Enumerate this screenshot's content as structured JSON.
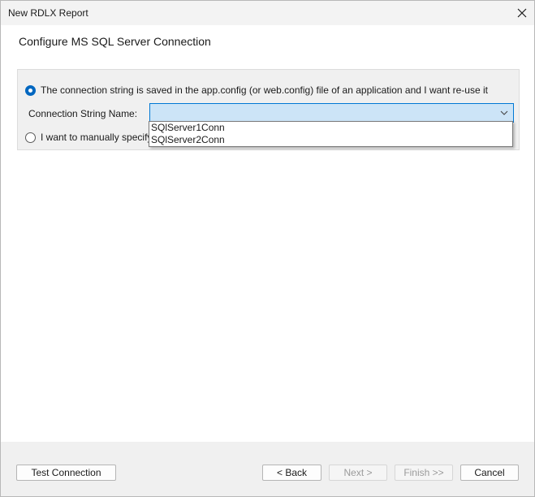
{
  "window": {
    "title": "New RDLX Report",
    "close_icon": "close-icon"
  },
  "page": {
    "heading": "Configure MS SQL Server Connection"
  },
  "options": {
    "use_config_label": "The connection string is saved in the app.config (or web.config) file of an application and I want re-use it",
    "use_config_checked": true,
    "manual_label": "I want to manually specify",
    "manual_checked": false
  },
  "connection_string": {
    "label": "Connection String Name:",
    "value": "",
    "dropdown_open": true,
    "options": [
      "SQlServer1Conn",
      "SQlServer2Conn"
    ]
  },
  "buttons": {
    "test_connection": "Test Connection",
    "back": "< Back",
    "next": "Next >",
    "finish": "Finish >>",
    "cancel": "Cancel"
  },
  "colors": {
    "accent": "#0067c0",
    "combo_focus_bg": "#cce4f7"
  }
}
